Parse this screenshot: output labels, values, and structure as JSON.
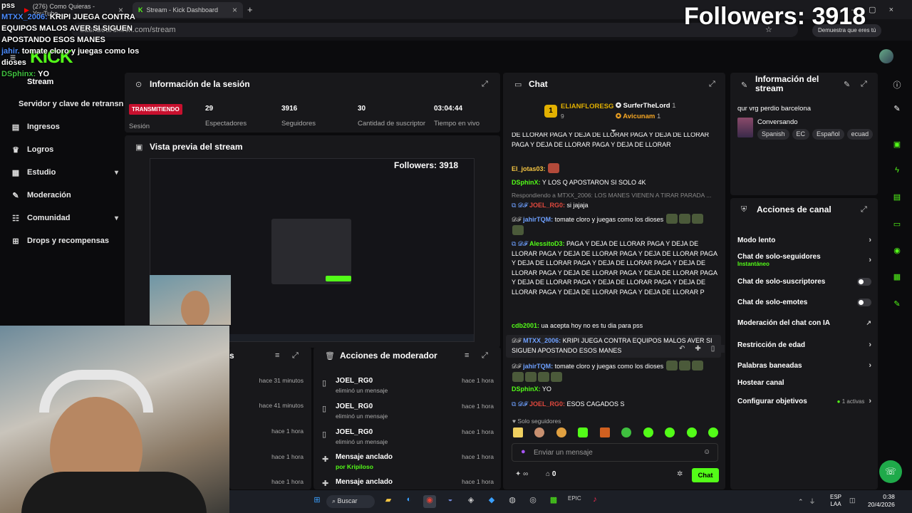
{
  "browser": {
    "tabs": [
      {
        "title": "(276) Como Quieras - YouTube",
        "active": false
      },
      {
        "title": "Stream - Kick Dashboard",
        "active": true
      }
    ],
    "url": "dashboard.kick.com/stream",
    "notice": "Demuestra que eres tú"
  },
  "overlay": {
    "followers": "Followers: 3918",
    "preview_followers": "Followers: 3918",
    "lines": [
      {
        "user": "",
        "text": "pss"
      },
      {
        "user": "MTXX_2006:",
        "text": "KRIPI JUEGA CONTRA EQUIPOS MALOS AVER SI SIGUEN APOSTANDO ESOS MANES"
      },
      {
        "user": "jahir.",
        "text": "tomate cloro y juegas como los dioses"
      },
      {
        "user": "DSphinx:",
        "text": "YO"
      }
    ]
  },
  "sidebar": {
    "logo": "KICK",
    "stream_label": "Stream",
    "items": [
      {
        "label": "Servidor y clave de retransn",
        "icon": "key-icon"
      },
      {
        "label": "Ingresos",
        "icon": "chart-icon"
      },
      {
        "label": "Logros",
        "icon": "trophy-icon"
      },
      {
        "label": "Estudio",
        "icon": "studio-icon",
        "chevron": true
      },
      {
        "label": "Moderación",
        "icon": "wrench-icon"
      },
      {
        "label": "Comunidad",
        "icon": "community-icon",
        "chevron": true
      },
      {
        "label": "Drops y recompensas",
        "icon": "drops-icon"
      }
    ]
  },
  "session": {
    "title": "Información de la sesión",
    "badge": "TRANSMITIENDO",
    "badge_label": "Sesión",
    "stats": [
      {
        "value": "29",
        "label": "Espectadores"
      },
      {
        "value": "3916",
        "label": "Seguidores"
      },
      {
        "value": "30",
        "label": "Cantidad de suscriptores"
      },
      {
        "value": "03:04:44",
        "label": "Tiempo en vivo"
      }
    ]
  },
  "preview": {
    "title": "Vista previa del stream"
  },
  "recent": {
    "times": [
      "hace 31 minutos",
      "hace 41 minutos",
      "hace 1 hora",
      "hace 1 hora",
      "hace 1 hora"
    ]
  },
  "mod_actions": {
    "title": "Acciones de moderador",
    "rows": [
      {
        "user": "JOEL_RG0",
        "action": "eliminó un mensaje",
        "time": "hace 1 hora"
      },
      {
        "user": "JOEL_RG0",
        "action": "eliminó un mensaje",
        "time": "hace 1 hora"
      },
      {
        "user": "JOEL_RG0",
        "action": "eliminó un mensaje",
        "time": "hace 1 hora"
      },
      {
        "user": "Mensaje anclado",
        "action": "por Kripiloso",
        "time": "hace 1 hora"
      },
      {
        "user": "Mensaje anclado",
        "action": "",
        "time": "hace 1 hora"
      }
    ]
  },
  "chat": {
    "title": "Chat",
    "top_gifter": {
      "rank": "1",
      "name": "ELIANFLORESG",
      "count": "9"
    },
    "gifters": [
      {
        "name": "SurferTheLord",
        "count": "1"
      },
      {
        "name": "Avicunam",
        "count": "1"
      }
    ],
    "messages": [
      {
        "user": "",
        "text": "DE LLORAR PAGA Y DEJA DE LLORAR PAGA Y DEJA DE LLORAR PAGA Y DEJA DE LLORAR PAGA Y DEJA DE LLORAR",
        "color": "#ffffff"
      },
      {
        "user": "El_jotas03:",
        "text": "",
        "color": "#f5c542"
      },
      {
        "user": "DSphinX:",
        "text": "Y LOS Q APOSTARON SI SOLO 4K",
        "color": "#53fc18"
      },
      {
        "user": "",
        "text": "Respondiendo a MTXX_2006: LOS MANES VIENEN A TIRAR PARADA ...",
        "color": "#888888"
      },
      {
        "user": "JOEL_RG0:",
        "text": "si jajaja",
        "color": "#e0483d"
      },
      {
        "user": "jahirTQM:",
        "text": "tomate cloro y juegas como los dioses",
        "color": "#6ea0ff"
      },
      {
        "user": "AlessitoD3:",
        "text": "PAGA Y DEJA DE LLORAR PAGA Y DEJA DE LLORAR PAGA Y DEJA DE LLORAR PAGA Y DEJA DE LLORAR PAGA Y DEJA DE LLORAR PAGA Y DEJA DE LLORAR PAGA Y DEJA DE LLORAR PAGA Y DEJA DE LLORAR PAGA Y DEJA DE LLORAR PAGA Y DEJA DE LLORAR PAGA Y DEJA DE LLORAR PAGA Y DEJA DE LLORAR PAGA Y DEJA DE LLORAR PAGA Y DEJA DE LLORAR P",
        "color": "#53fc18"
      },
      {
        "user": "cdb2001:",
        "text": "ua acepta hoy no es tu dia para pss",
        "color": "#53fc18"
      },
      {
        "user": "MTXX_2006:",
        "text": "KRIPI JUEGA CONTRA EQUIPOS MALOS AVER SI SIGUEN APOSTANDO ESOS MANES",
        "color": "#6ea0ff"
      },
      {
        "user": "jahirTQM:",
        "text": "tomate cloro y juegas como los dioses",
        "color": "#6ea0ff"
      },
      {
        "user": "DSphinX:",
        "text": "YO",
        "color": "#53fc18"
      },
      {
        "user": "JOEL_RG0:",
        "text": "ESOS CAGADOS S",
        "color": "#e0483d"
      }
    ],
    "followers_only": "Solo seguidores",
    "input_placeholder": "Enviar un mensaje",
    "infinity": "∞",
    "count": "0",
    "send_label": "Chat"
  },
  "stream_info": {
    "title": "Información del stream",
    "stream_title": "qur vrg perdio barcelona",
    "category": "Conversando",
    "tags": [
      "Spanish",
      "EC",
      "Español",
      "ecuad"
    ]
  },
  "channel_actions": {
    "title": "Acciones de canal",
    "items": [
      {
        "label": "Modo lento",
        "control": "chevron",
        "sub": ""
      },
      {
        "label": "Chat de solo-seguidores",
        "control": "chevron",
        "sub": "Instantáneo"
      },
      {
        "label": "Chat de solo-suscriptores",
        "control": "toggle",
        "sub": ""
      },
      {
        "label": "Chat de solo-emotes",
        "control": "toggle",
        "sub": ""
      },
      {
        "label": "Moderación del chat con IA",
        "control": "external",
        "sub": ""
      },
      {
        "label": "Restricción de edad",
        "control": "chevron",
        "sub": ""
      },
      {
        "label": "Palabras baneadas",
        "control": "chevron",
        "sub": ""
      },
      {
        "label": "Hostear canal",
        "control": "none",
        "sub": ""
      },
      {
        "label": "Configurar objetivos",
        "control": "chevron",
        "sub": "1 activas"
      }
    ]
  },
  "taskbar": {
    "search": "Buscar",
    "lang": "ESP",
    "lang2": "LAA",
    "time": "0:38",
    "date": "20/4/2026"
  },
  "colors": {
    "accent": "#53fc18",
    "live": "#c8102e"
  }
}
